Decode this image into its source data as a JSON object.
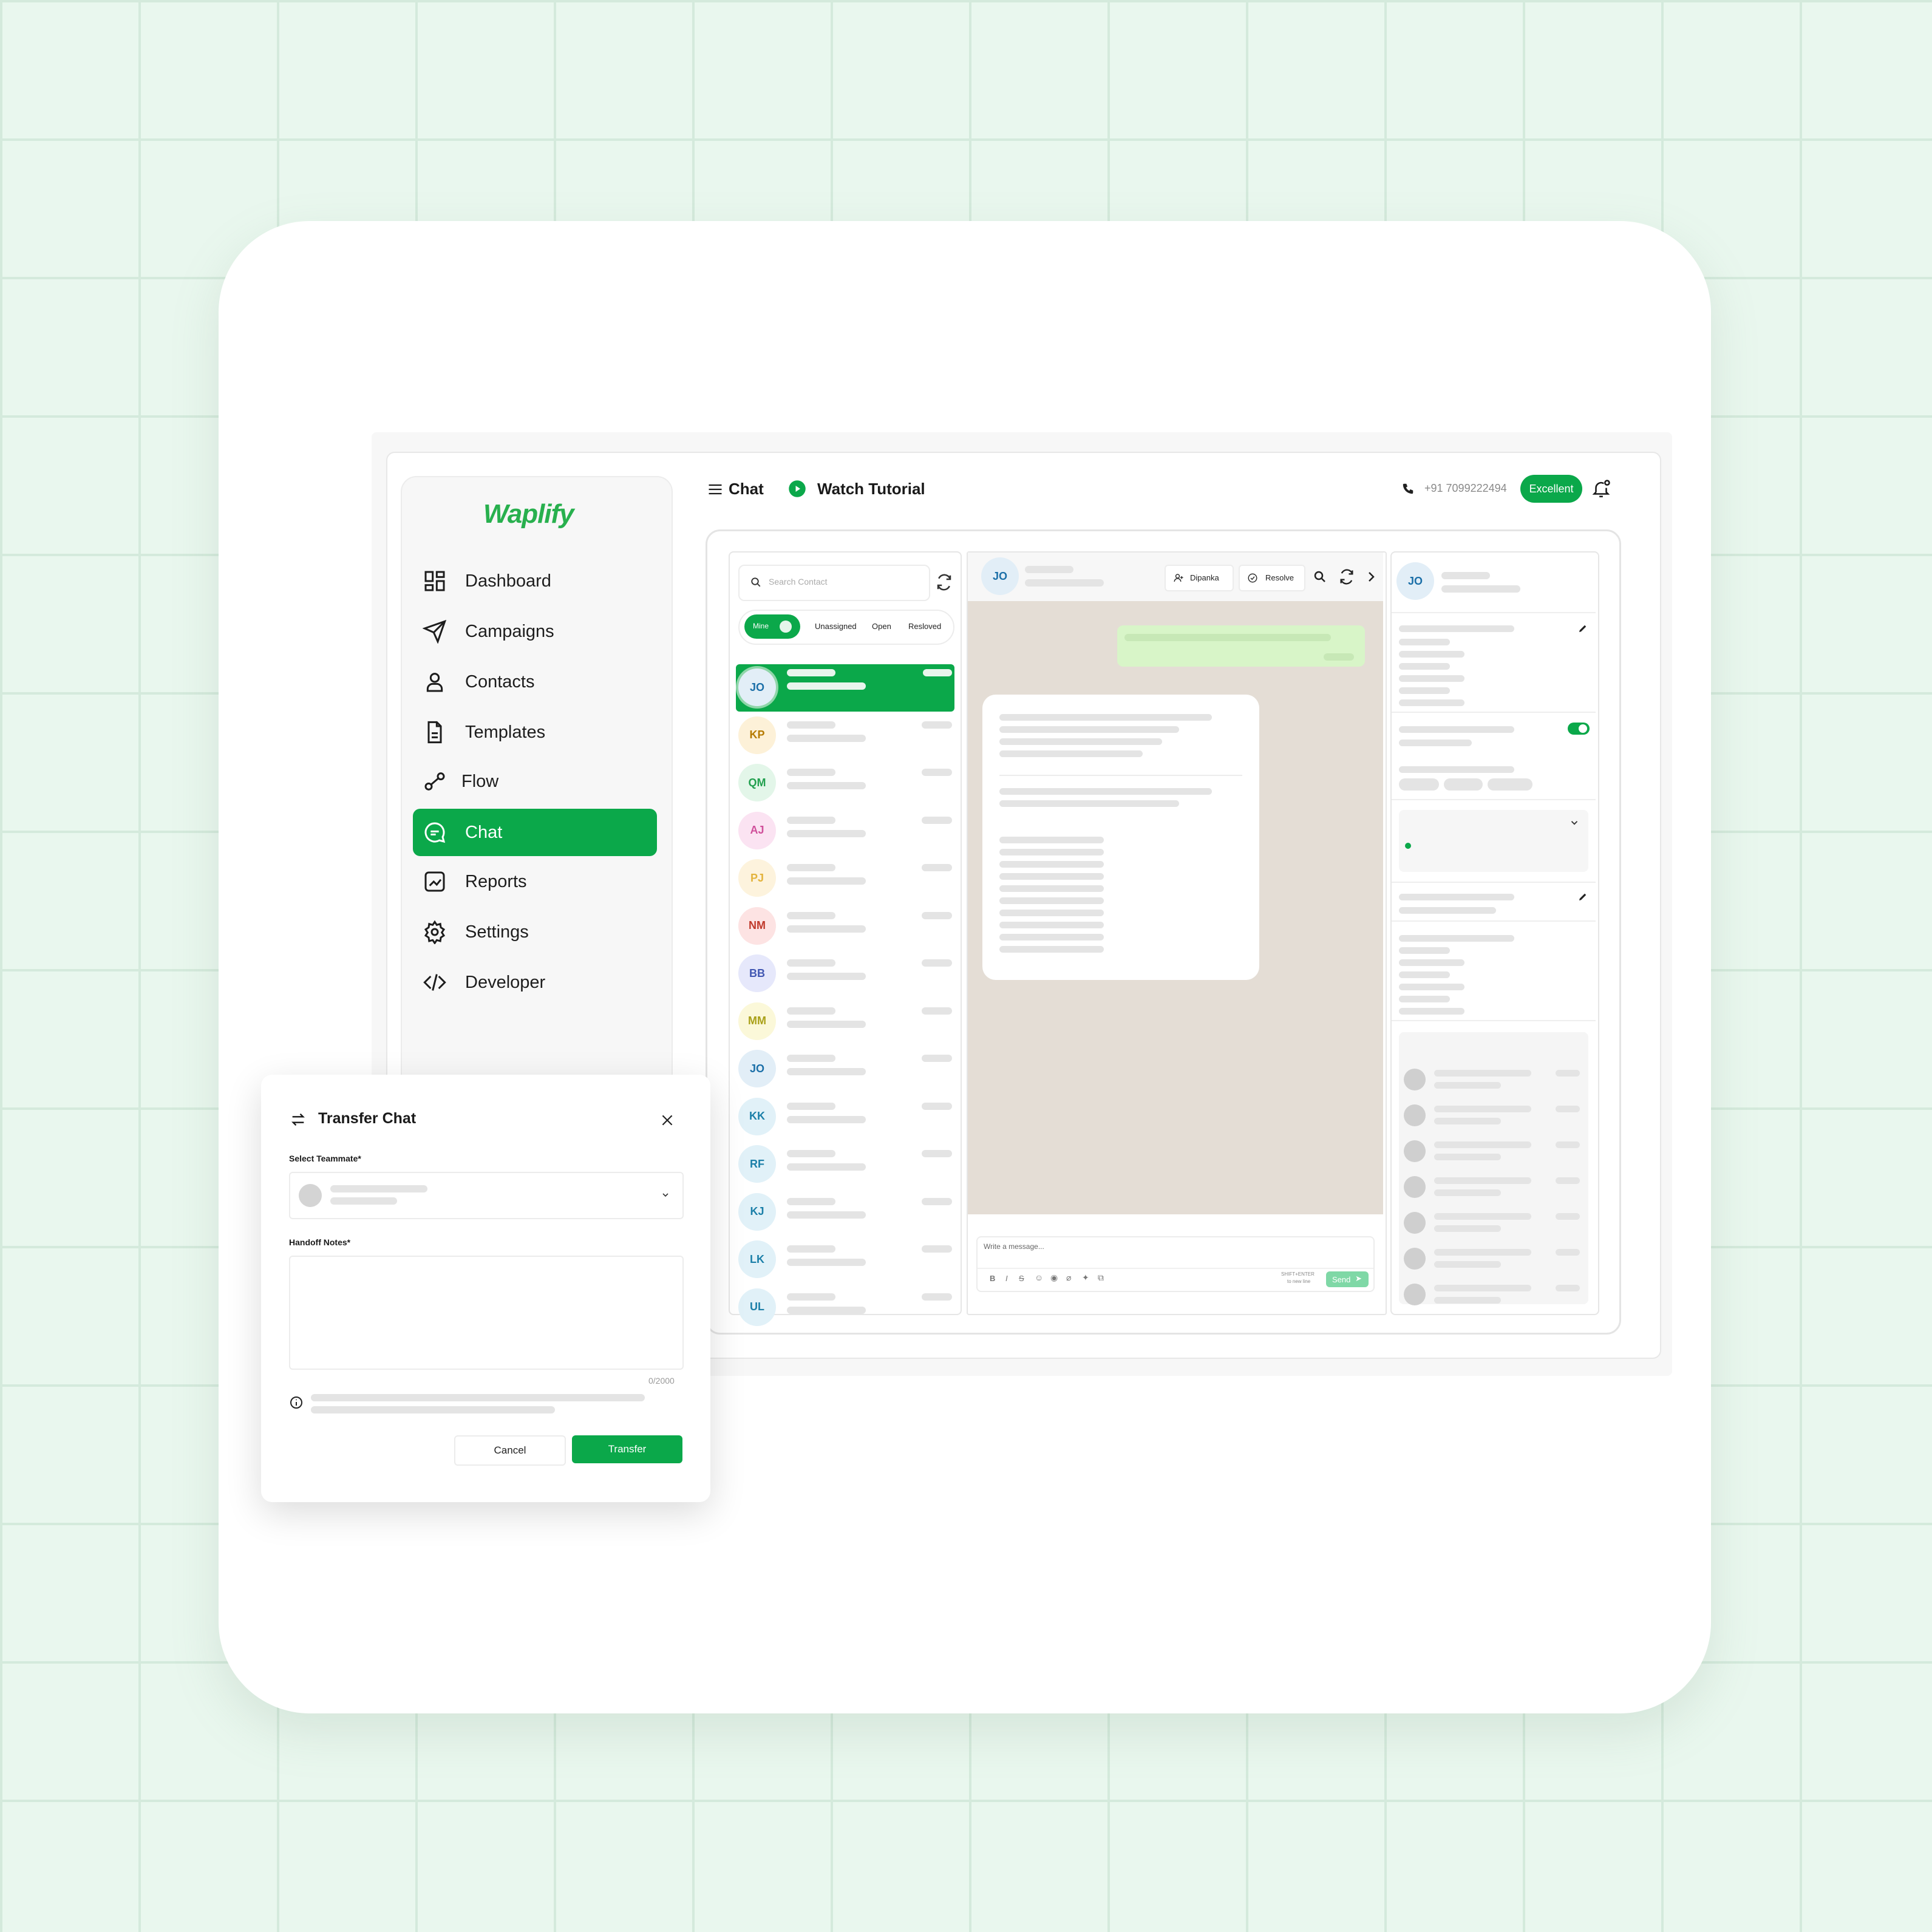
{
  "app": {
    "brand": "Waplify",
    "accent": "#0ba84a"
  },
  "sidebar": {
    "items": [
      {
        "label": "Dashboard",
        "icon": "dashboard-icon"
      },
      {
        "label": "Campaigns",
        "icon": "send-icon"
      },
      {
        "label": "Contacts",
        "icon": "user-icon"
      },
      {
        "label": "Templates",
        "icon": "document-icon"
      },
      {
        "label": "Flow",
        "icon": "flow-icon"
      },
      {
        "label": "Chat",
        "icon": "chat-icon",
        "active": true
      },
      {
        "label": "Reports",
        "icon": "reports-icon"
      },
      {
        "label": "Settings",
        "icon": "gear-icon"
      },
      {
        "label": "Developer",
        "icon": "code-icon"
      }
    ]
  },
  "header": {
    "page_title": "Chat",
    "tutorial_label": "Watch Tutorial",
    "phone": "+91 7099222494",
    "quality_badge": "Excellent"
  },
  "conversations": {
    "search_placeholder": "Search Contact",
    "filters": [
      "Mine",
      "Unassigned",
      "Open",
      "Resloved"
    ],
    "contacts": [
      "JO",
      "KP",
      "QM",
      "AJ",
      "PJ",
      "NM",
      "BB",
      "MM",
      "JO",
      "KK",
      "RF",
      "KJ",
      "LK",
      "UL"
    ]
  },
  "chat": {
    "contact_initials": "JO",
    "assignee": "Dipanka",
    "resolve_label": "Resolve",
    "composer_placeholder": "Write a message...",
    "shift_hint_1": "SHIFT+ENTER",
    "shift_hint_2": "to new line",
    "send_label": "Send"
  },
  "details": {
    "contact_initials": "JO"
  },
  "modal": {
    "title": "Transfer Chat",
    "teammate_label": "Select Teammate*",
    "notes_label": "Handoff Notes*",
    "char_count": "0/2000",
    "cancel_label": "Cancel",
    "transfer_label": "Transfer"
  }
}
